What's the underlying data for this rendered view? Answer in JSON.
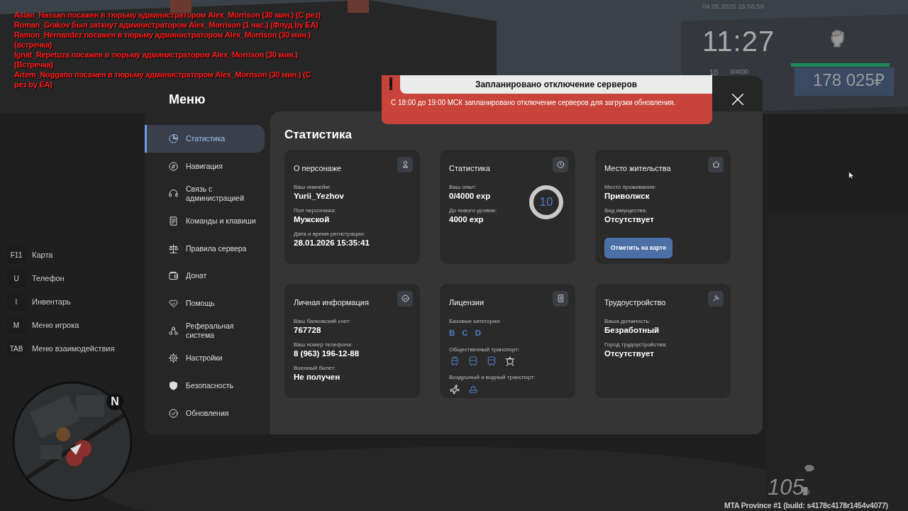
{
  "chat_log": [
    {
      "text": "Aslan_Hassan посажен в тюрьму администратором Alex_Morrison (30 мин.) (С рез)"
    },
    {
      "text": "Roman_Grakov был заткнут администратором Alex_Morrison (1 час.) (Флуд by EA)"
    },
    {
      "text": "Ramon_Hernandez посажен в тюрьму администратором Alex_Morrison (30 мин.) (встречка)"
    },
    {
      "text": "Ignat_Repetuza посажен в тюрьму администратором Alex_Morrison (30 мин.) (Встречка)"
    },
    {
      "text": "Artem_Noggano посажен в тюрьму администратором Alex_Morrison (30 мин.) (С рез by EA)"
    }
  ],
  "hud": {
    "datetime": "04.05.2026 15:58:56",
    "clock": "11:27",
    "level_number": "10",
    "exp": "0/4000",
    "health": {
      "level": 1
    },
    "money": "178 025₽"
  },
  "key_hints": [
    {
      "key": "F11",
      "label": "Карта"
    },
    {
      "key": "U",
      "label": "Телефон"
    },
    {
      "key": "I",
      "label": "Инвентарь"
    },
    {
      "key": "M",
      "label": "Меню игрока"
    },
    {
      "key": "TAB",
      "label": "Меню взаимодействия"
    }
  ],
  "minimap": {
    "compass": "N"
  },
  "menu": {
    "title": "Меню",
    "sidebar": [
      {
        "label": "Статистика",
        "selected": true
      },
      {
        "label": "Навигация",
        "selected": false
      },
      {
        "label": "Связь с администрацией",
        "selected": false
      },
      {
        "label": "Команды и клавиши",
        "selected": false
      },
      {
        "label": "Правила сервера",
        "selected": false
      },
      {
        "label": "Донат",
        "selected": false
      },
      {
        "label": "Помощь",
        "selected": false
      },
      {
        "label": "Реферальная система",
        "selected": false
      },
      {
        "label": "Настройки",
        "selected": false
      },
      {
        "label": "Безопасность",
        "selected": false
      },
      {
        "label": "Обновления",
        "selected": false
      }
    ],
    "heading": "Статистика",
    "cards": [
      {
        "kind": "fields",
        "title": "О персонаже",
        "fields": [
          {
            "label": "Ваш никнейм:",
            "value": "Yurii_Yezhov"
          },
          {
            "label": "Пол персонажа:",
            "value": "Мужской"
          },
          {
            "label": "Дата и время регистрации:",
            "value": "28.01.2026 15:35:41"
          }
        ]
      },
      {
        "kind": "stats",
        "title": "Статистика",
        "fields": [
          {
            "label": "Ваш опыт:",
            "value": "0/4000 exp"
          },
          {
            "label": "До нового уровня:",
            "value": "4000 exp"
          }
        ],
        "ring": {
          "text": "10",
          "level": 0
        }
      },
      {
        "kind": "fields",
        "title": "Место жительства",
        "fields": [
          {
            "label": "Место проживания:",
            "value": "Приволжск"
          },
          {
            "label": "Вид имущества:",
            "value": "Отсутствует"
          }
        ],
        "button": "Отметить на карте"
      },
      {
        "kind": "fields",
        "title": "Личная информация",
        "fields": [
          {
            "label": "Ваш банковский счет:",
            "value": "767728"
          },
          {
            "label": "Ваш номер телефона:",
            "value": "8 (963) 196-12-88"
          },
          {
            "label": "Военный билет:",
            "value": "Не получен"
          }
        ]
      },
      {
        "kind": "licenses",
        "title": "Лицензии",
        "sections": [
          {
            "kind": "letters",
            "label": "Базовые категории:",
            "letters": [
              "B",
              "C",
              "D"
            ]
          },
          {
            "kind": "icons",
            "label": "Общественный транспорт:",
            "items": [
              {
                "owned": true
              },
              {
                "owned": true
              },
              {
                "owned": true
              },
              {
                "owned": false
              }
            ]
          },
          {
            "kind": "icons",
            "label": "Воздушный и водный транспорт:",
            "items": [
              {
                "owned": false
              },
              {
                "owned": true
              }
            ]
          }
        ]
      },
      {
        "kind": "fields",
        "title": "Трудоустройство",
        "fields": [
          {
            "label": "Ваша должность:",
            "value": "Безработный"
          },
          {
            "label": "Город трудоустройства:",
            "value": "Отсутствует"
          }
        ]
      }
    ]
  },
  "notification": {
    "title": "Запланировано отключение серверов",
    "text": "С 18:00 до 19:00 МСК запланировано отключение серверов для загрузки обновления."
  },
  "vehicle": {
    "speed": "105"
  },
  "build_info": "MTA Province #1 (build: s4178c4178r1454v4077)"
}
